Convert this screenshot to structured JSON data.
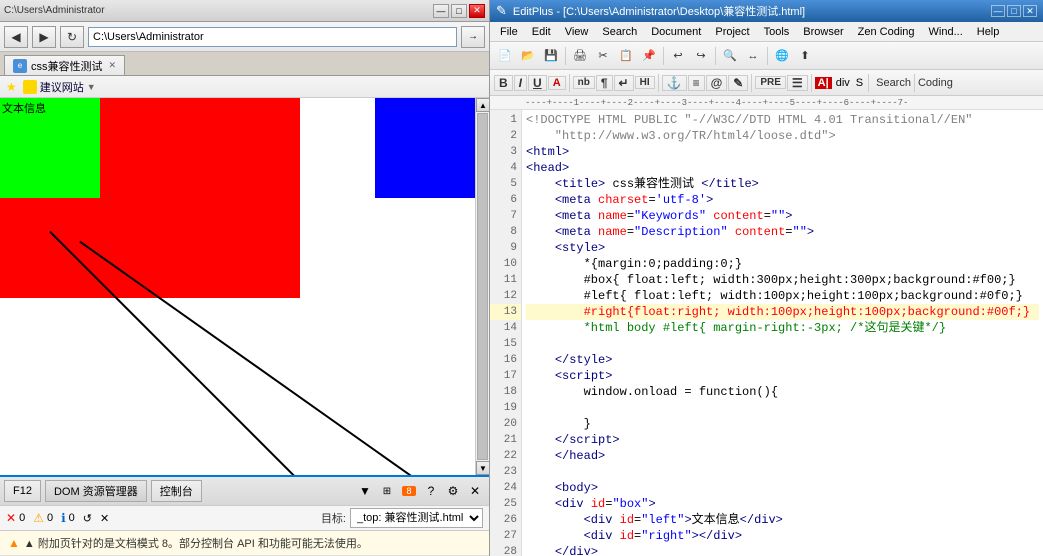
{
  "browser": {
    "titlebar": {
      "path": "C:\\Users\\Administrator",
      "title": "css兼容性测试",
      "min_label": "—",
      "max_label": "□",
      "close_label": "✕"
    },
    "address": "C:\\Users\\Administrator",
    "tab_title": "css兼容性测试",
    "favorites": {
      "label": "建议网站",
      "arrow": "▼"
    },
    "devtools": {
      "f12_label": "F12",
      "dom_label": "DOM 资源管理器",
      "console_label": "控制台",
      "count_8": "8",
      "error_count": "0",
      "warn_count": "0",
      "info_count": "0"
    },
    "console": {
      "target_label": "目标:",
      "target_value": "_top: 兼容性测试.html",
      "message": "▲ 附加页针对的是文档模式 8。部分控制台 API 和功能可能无法使用。"
    },
    "demo": {
      "text_info": "文本信息"
    }
  },
  "editor": {
    "titlebar": {
      "title": "EditPlus - [C:\\Users\\Administrator\\Desktop\\兼容性测试.html]",
      "min_label": "—",
      "max_label": "□",
      "close_label": "✕"
    },
    "menu": {
      "items": [
        "File",
        "Edit",
        "View",
        "Search",
        "Document",
        "Project",
        "Tools",
        "Browser",
        "Zen Coding",
        "Wind...",
        "Help"
      ]
    },
    "toolbar2": {
      "bold": "B",
      "italic": "I",
      "underline": "U",
      "colored_a": "A",
      "nb": "nb",
      "nbsp": "¶",
      "tab": "↵",
      "hi": "HI",
      "anchor": "⚓",
      "equals": "≡",
      "at": "@",
      "edit": "✎",
      "pre": "PRE",
      "list": "☰",
      "a_label": "A|",
      "div": "div S",
      "search_label": "Search",
      "coding_label": "Coding"
    },
    "ruler": "----+----1----+----2----+----3----+----4----+----5----+----6----+----7-",
    "lines": [
      {
        "num": 1,
        "html": "<span class='c-doctype'>&lt;!DOCTYPE HTML PUBLIC \"-//W3C//DTD HTML 4.01 Transitional//EN\"</span>"
      },
      {
        "num": 2,
        "html": "<span class='c-doctype'>    \"http://www.w3.org/TR/html4/loose.dtd\"&gt;</span>"
      },
      {
        "num": 3,
        "html": "<span class='c-tag'>&lt;html&gt;</span>"
      },
      {
        "num": 4,
        "html": "<span class='c-tag'>&lt;head&gt;</span>"
      },
      {
        "num": 5,
        "html": "    <span class='c-tag'>&lt;title&gt;</span> <span class='c-text'>css兼容性测试</span> <span class='c-tag'>&lt;/title&gt;</span>"
      },
      {
        "num": 6,
        "html": "    <span class='c-tag'>&lt;meta</span> <span class='c-attr'>charset</span>=<span class='c-val'>'utf-8'</span><span class='c-tag'>&gt;</span>"
      },
      {
        "num": 7,
        "html": "    <span class='c-tag'>&lt;meta</span> <span class='c-attr'>name</span>=<span class='c-val'>\"Keywords\"</span> <span class='c-attr'>content</span>=<span class='c-val'>\"\"</span><span class='c-tag'>&gt;</span>"
      },
      {
        "num": 8,
        "html": "    <span class='c-tag'>&lt;meta</span> <span class='c-attr'>name</span>=<span class='c-val'>\"Description\"</span> <span class='c-attr'>content</span>=<span class='c-val'>\"\"</span><span class='c-tag'>&gt;</span>"
      },
      {
        "num": 9,
        "html": "    <span class='c-tag'>&lt;style&gt;</span>"
      },
      {
        "num": 10,
        "html": "        <span class='c-text'>*{margin:0;padding:0;}</span>"
      },
      {
        "num": 11,
        "html": "        <span class='c-text'>#box{ float:left; width:300px;height:300px;background:#f00;}</span>"
      },
      {
        "num": 12,
        "html": "        <span class='c-text'>#left{ float:left; width:100px;height:100px;background:#0f0;}</span>"
      },
      {
        "num": 13,
        "html": "        <span class='c-red'>#right{float:right; width:100px;height:100px;background:#00f;}</span>"
      },
      {
        "num": 14,
        "html": "        <span class='c-comment'>*html body #left{ margin-right:-3px; /*这句是关键*/}</span>"
      },
      {
        "num": 15,
        "html": ""
      },
      {
        "num": 16,
        "html": "    <span class='c-tag'>&lt;/style&gt;</span>"
      },
      {
        "num": 17,
        "html": "    <span class='c-tag'>&lt;script&gt;</span>"
      },
      {
        "num": 18,
        "html": "        <span class='c-keyword'>window.onload</span> <span class='c-text'>= function(){</span>"
      },
      {
        "num": 19,
        "html": ""
      },
      {
        "num": 20,
        "html": "        <span class='c-text'>}</span>"
      },
      {
        "num": 21,
        "html": "    <span class='c-tag'>&lt;/script&gt;</span>"
      },
      {
        "num": 22,
        "html": "    <span class='c-tag'>&lt;/head&gt;</span>"
      },
      {
        "num": 23,
        "html": ""
      },
      {
        "num": 24,
        "html": "    <span class='c-tag'>&lt;body&gt;</span>"
      },
      {
        "num": 25,
        "html": "    <span class='c-tag'>&lt;div</span> <span class='c-attr'>id</span>=<span class='c-val'>\"box\"</span><span class='c-tag'>&gt;</span>"
      },
      {
        "num": 26,
        "html": "        <span class='c-tag'>&lt;div</span> <span class='c-attr'>id</span>=<span class='c-val'>\"left\"</span><span class='c-tag'>&gt;</span><span class='c-text'>文本信息</span><span class='c-tag'>&lt;/div&gt;</span>"
      },
      {
        "num": 27,
        "html": "        <span class='c-tag'>&lt;div</span> <span class='c-attr'>id</span>=<span class='c-val'>\"right\"</span><span class='c-tag'>&gt;&lt;/div&gt;</span>"
      },
      {
        "num": 28,
        "html": "    <span class='c-tag'>&lt;/div&gt;</span>"
      }
    ]
  }
}
